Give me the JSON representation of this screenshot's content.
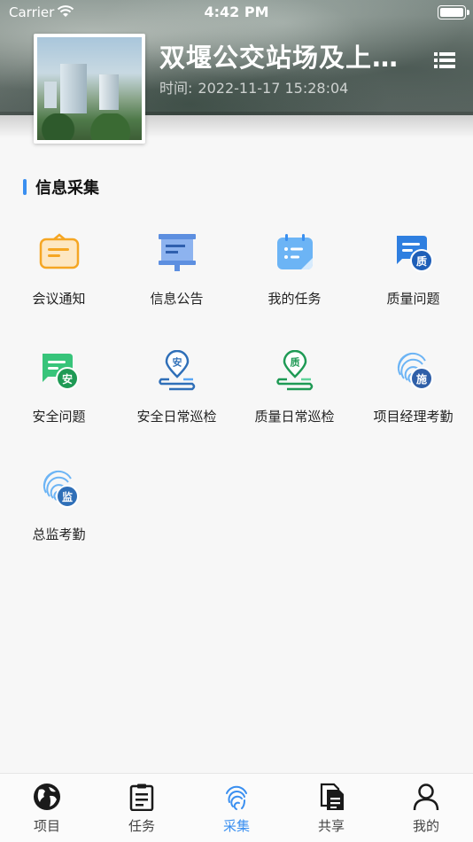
{
  "status_bar": {
    "carrier": "Carrier",
    "time": "4:42 PM"
  },
  "project": {
    "title": "双堰公交站场及上…",
    "time_label": "时间:",
    "time_value": "2022-11-17 15:28:04"
  },
  "section": {
    "title": "信息采集"
  },
  "items": [
    {
      "label": "会议通知",
      "icon": "meeting-notice-icon"
    },
    {
      "label": "信息公告",
      "icon": "announcement-icon"
    },
    {
      "label": "我的任务",
      "icon": "my-tasks-icon"
    },
    {
      "label": "质量问题",
      "icon": "quality-issue-icon",
      "badge": "质"
    },
    {
      "label": "安全问题",
      "icon": "safety-issue-icon",
      "badge": "安"
    },
    {
      "label": "安全日常巡检",
      "icon": "safety-patrol-icon",
      "badge": "安"
    },
    {
      "label": "质量日常巡检",
      "icon": "quality-patrol-icon",
      "badge": "质"
    },
    {
      "label": "项目经理考勤",
      "icon": "pm-attendance-icon",
      "badge": "施"
    },
    {
      "label": "总监考勤",
      "icon": "supervisor-attendance-icon",
      "badge": "监"
    }
  ],
  "tabs": [
    {
      "label": "项目",
      "icon": "globe-icon"
    },
    {
      "label": "任务",
      "icon": "clipboard-icon"
    },
    {
      "label": "采集",
      "icon": "fingerprint-icon",
      "active": true
    },
    {
      "label": "共享",
      "icon": "documents-icon"
    },
    {
      "label": "我的",
      "icon": "user-icon"
    }
  ],
  "colors": {
    "accent": "#3a8ff0",
    "orange": "#f5a623",
    "green": "#2eb872",
    "dark_blue": "#2f6fb8"
  }
}
